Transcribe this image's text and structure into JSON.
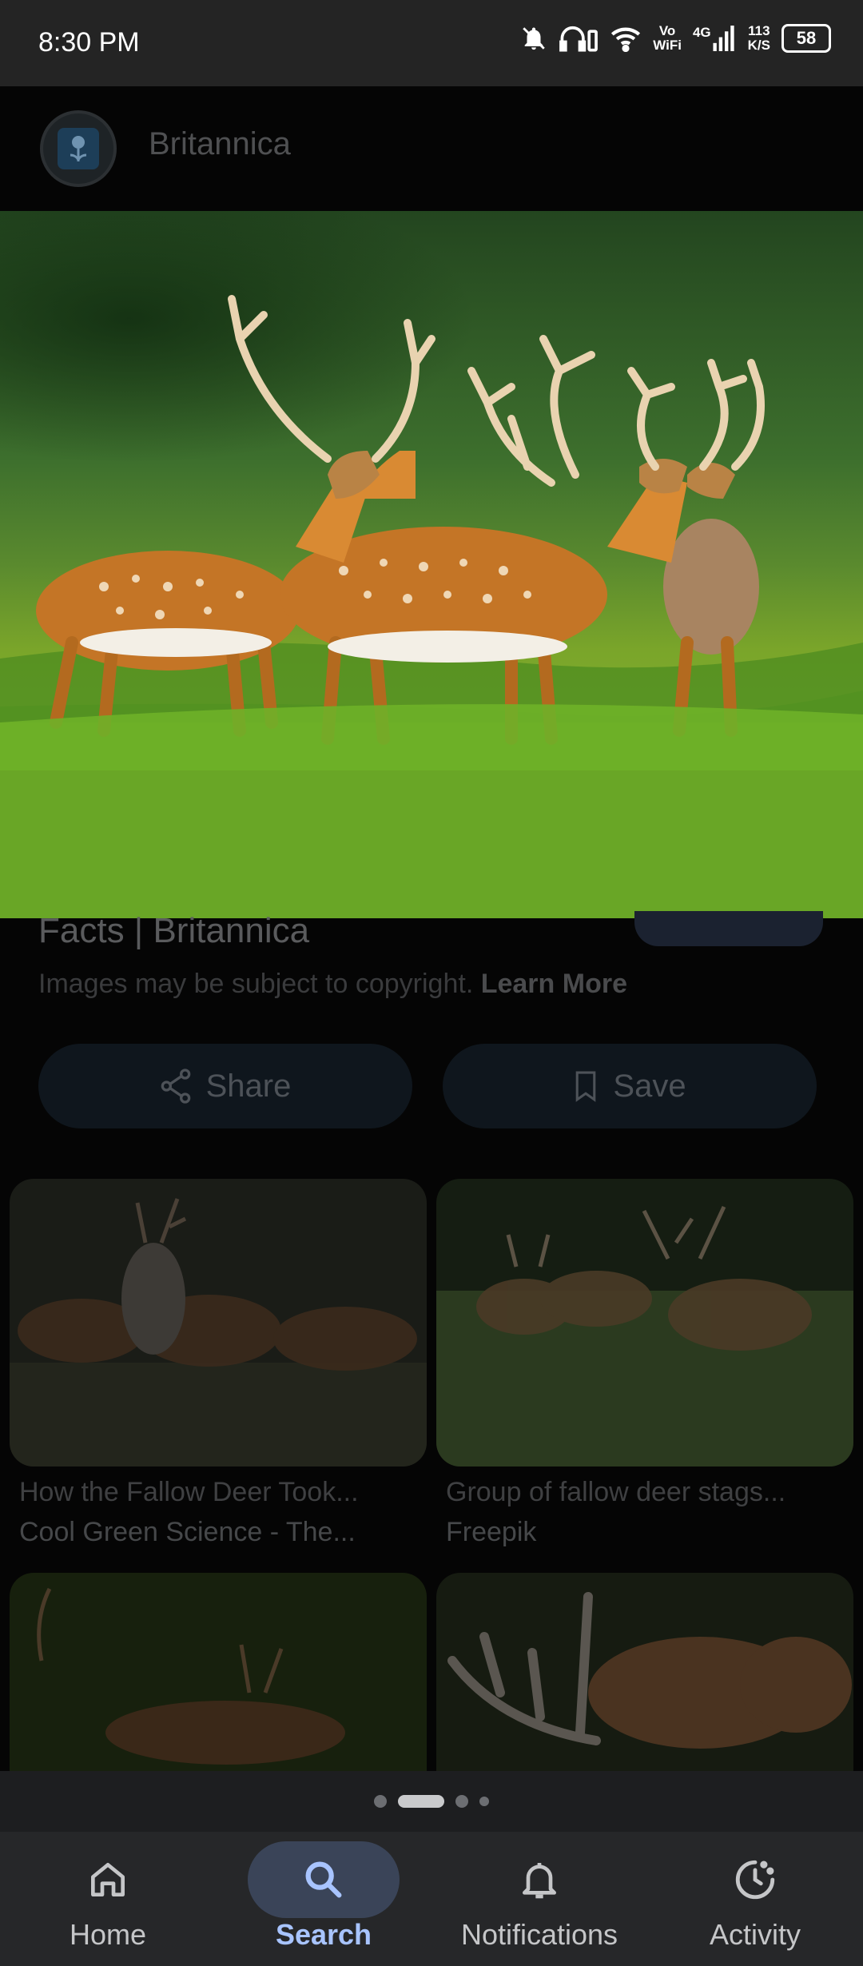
{
  "status_bar": {
    "time": "8:30 PM",
    "vo_wifi_top": "Vo",
    "vo_wifi_bottom": "WiFi",
    "network": "4G",
    "speed_value": "113",
    "speed_unit": "K/S",
    "battery": "58"
  },
  "header": {
    "source_name": "Britannica"
  },
  "result": {
    "title": "Facts | Britannica",
    "copyright_text": "Images may be subject to copyright.",
    "learn_more": "Learn More",
    "share_label": "Share",
    "save_label": "Save"
  },
  "related": [
    {
      "title": "How the Fallow Deer Took...",
      "source": "Cool Green Science - The..."
    },
    {
      "title": "Group of fallow deer stags...",
      "source": "Freepik"
    }
  ],
  "bottom_nav": [
    {
      "label": "Home",
      "icon": "home-icon"
    },
    {
      "label": "Search",
      "icon": "search-icon",
      "active": true
    },
    {
      "label": "Notifications",
      "icon": "bell-icon"
    },
    {
      "label": "Activity",
      "icon": "activity-icon"
    }
  ],
  "pager": {
    "current_page": 2,
    "total_pages": 4
  }
}
